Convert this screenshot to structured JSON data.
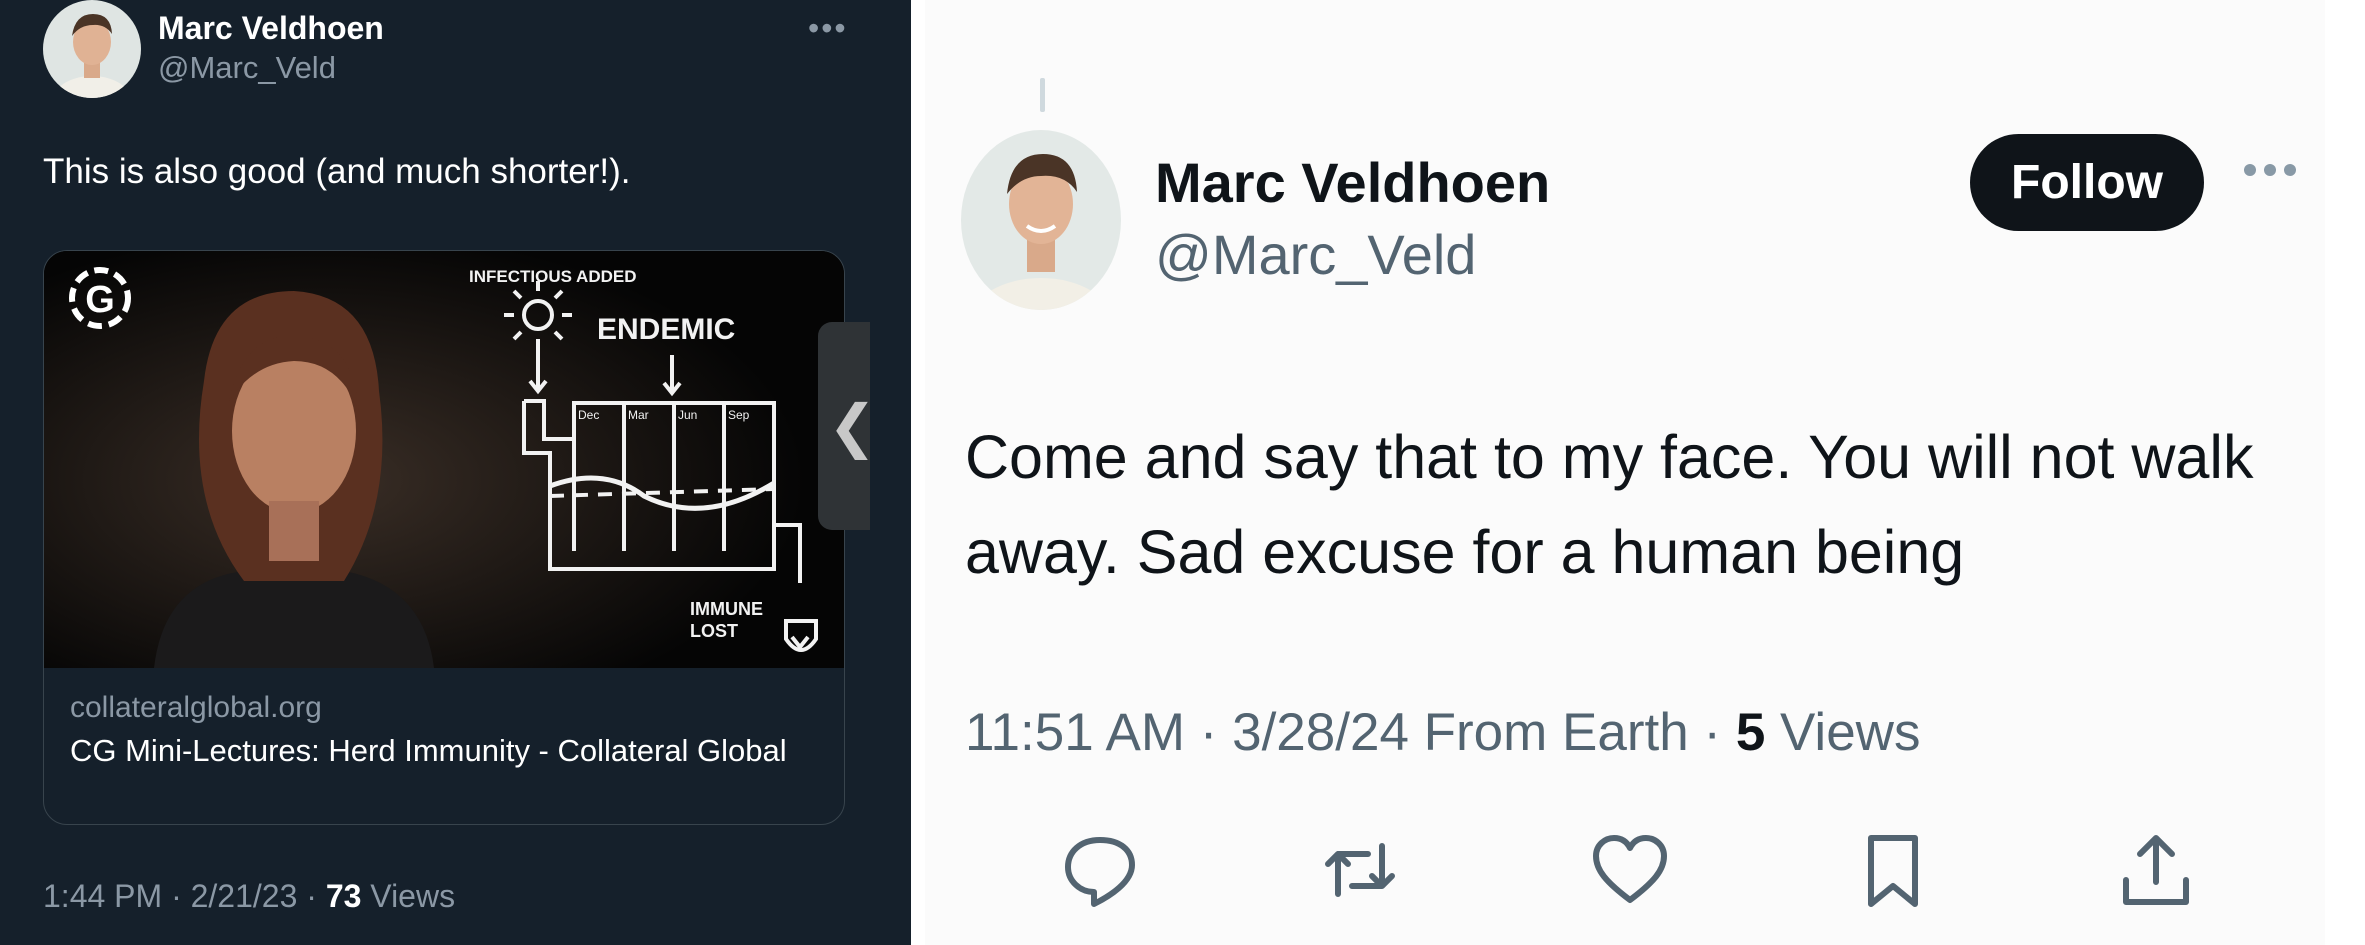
{
  "left_tweet": {
    "author": {
      "name": "Marc Veldhoen",
      "handle": "@Marc_Veld"
    },
    "more_icon": "ellipsis-icon",
    "text": "This is also good (and much shorter!).",
    "link_card": {
      "image": {
        "logo": "G",
        "label_top": "INFECTIOUS ADDED",
        "label_endemic": "ENDEMIC",
        "months": [
          "Dec",
          "Mar",
          "Jun",
          "Sep"
        ],
        "label_bottom_1": "IMMUNE",
        "label_bottom_2": "LOST"
      },
      "domain": "collateralglobal.org",
      "title": "CG Mini-Lectures: Herd Immunity - Collateral Global"
    },
    "meta": {
      "time_date": "1:44 PM · 2/21/23 · ",
      "views_count": "73",
      "views_label": " Views"
    },
    "colors": {
      "background": "#15202b",
      "secondary_text": "#8b98a5"
    }
  },
  "right_tweet": {
    "author": {
      "name": "Marc Veldhoen",
      "handle": "@Marc_Veld"
    },
    "follow_label": "Follow",
    "more_icon": "ellipsis-icon",
    "text": "Come and say that to my face. You will not walk away. Sad excuse for a human being",
    "meta": {
      "time_date": "11:51 AM · 3/28/24 From Earth · ",
      "views_count": "5",
      "views_label": " Views"
    },
    "actions": [
      "reply-icon",
      "retweet-icon",
      "like-icon",
      "bookmark-icon",
      "share-icon"
    ],
    "colors": {
      "follow_button": "#0f1419",
      "secondary_text": "#536471"
    }
  }
}
